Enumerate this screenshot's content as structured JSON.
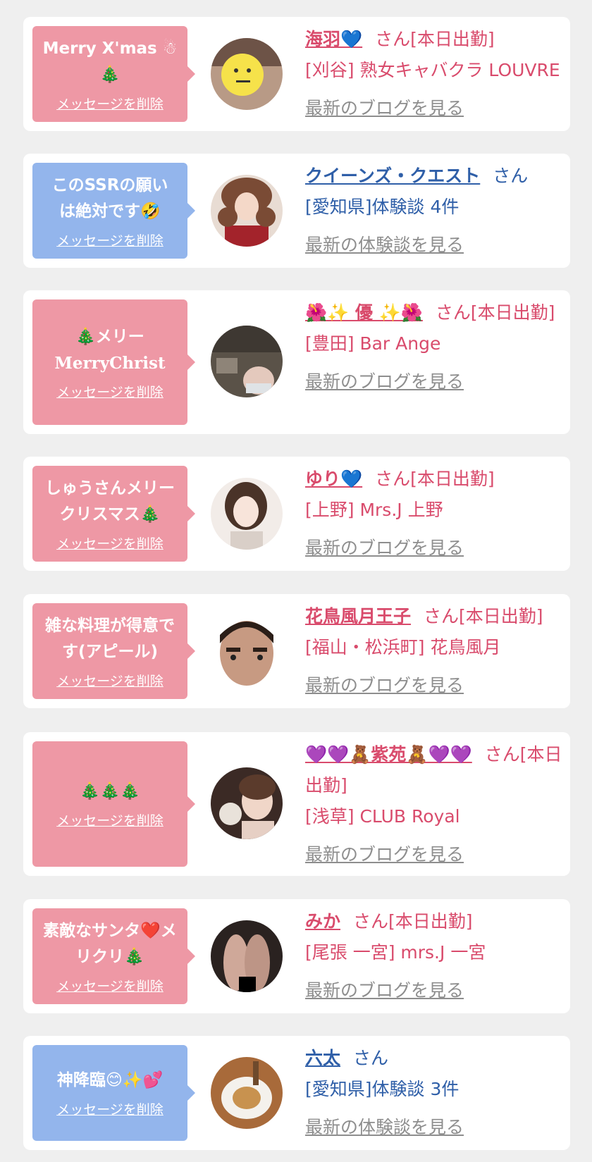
{
  "colors": {
    "pink_bubble": "#ee98a5",
    "blue_bubble": "#93b5ec",
    "pink_text": "#d94b6c",
    "blue_text": "#2f5fa8",
    "link_gray": "#8e8e8e",
    "background": "#efefef"
  },
  "delete_label": "メッセージを削除",
  "cards": [
    {
      "message": "Merry X'mas ☃🎄",
      "name": "海羽💙",
      "honorific": "さん[本日出勤]",
      "shop": "[刈谷] 熟女キャバクラ LOUVRE",
      "link": "最新のブログを見る"
    },
    {
      "message": "このSSRの願いは絶対です🤣",
      "name": "クイーンズ・クエスト",
      "honorific": "さん",
      "shop": "[愛知県]体験談 4件",
      "link": "最新の体験談を見る"
    },
    {
      "message_line1": "🎄メリー",
      "message_line2": "MerryChrist",
      "name": "🌺✨ 優 ✨🌺",
      "honorific": "さん[本日出勤]",
      "shop": "[豊田] Bar Ange",
      "link": "最新のブログを見る"
    },
    {
      "message": "しゅうさんメリークリスマス🎄",
      "name": "ゆり💙",
      "honorific": "さん[本日出勤]",
      "shop": "[上野] Mrs.J 上野",
      "link": "最新のブログを見る"
    },
    {
      "message": "雑な料理が得意です(アピール)",
      "name": "花鳥風月王子",
      "honorific": "さん[本日出勤]",
      "shop": "[福山・松浜町] 花鳥風月",
      "link": "最新のブログを見る"
    },
    {
      "message": "🎄🎄🎄",
      "name": "💜💜🧸紫苑🧸💜💜",
      "honorific": "さん[本日出勤]",
      "shop": "[浅草] CLUB Royal",
      "link": "最新のブログを見る"
    },
    {
      "message": "素敵なサンタ❤️メリクリ🎄",
      "name": "みか",
      "honorific": "さん[本日出勤]",
      "shop": "[尾張 一宮] mrs.J 一宮",
      "link": "最新のブログを見る"
    },
    {
      "message": "神降臨😊✨💕",
      "name": "六太",
      "honorific": "さん",
      "shop": "[愛知県]体験談 3件",
      "link": "最新の体験談を見る"
    }
  ]
}
